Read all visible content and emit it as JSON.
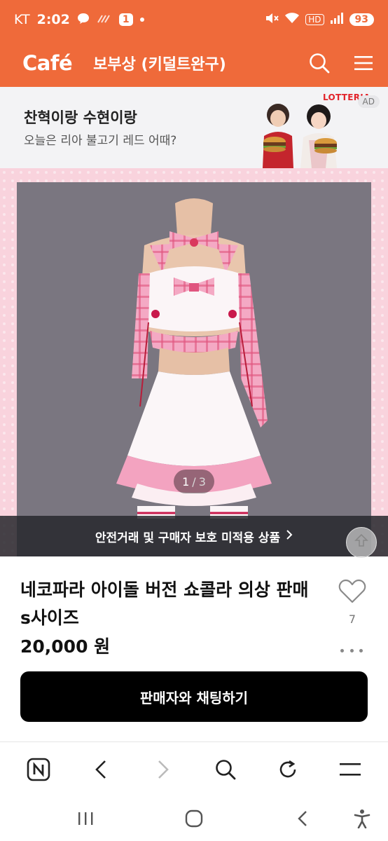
{
  "status_bar": {
    "carrier": "KT",
    "time": "2:02",
    "notification_count": "1",
    "network": "HD",
    "battery": "93"
  },
  "header": {
    "logo": "Café",
    "cafe_name": "보부상 (키덜트완구)"
  },
  "ad": {
    "title": "찬혁이랑 수현이랑",
    "subtitle": "오늘은 리아 불고기 레드 어때?",
    "brand": "LOTTERIA",
    "badge": "AD"
  },
  "gallery": {
    "current": "1",
    "separator": "/",
    "total": "3",
    "safety_notice": "안전거래 및 구매자 보호 미적용 상품"
  },
  "product": {
    "title": "네코파라 아이돌 버전 쇼콜라 의상 판매 s사이즈",
    "price": "20,000 원",
    "likes": "7"
  },
  "chat_button": {
    "label": "판매자와 채팅하기"
  },
  "colors": {
    "brand_orange": "#ef6a3a",
    "ad_brand_red": "#e2232a"
  },
  "icons": {
    "header": [
      "search-icon",
      "menu-icon"
    ],
    "browser_nav": [
      "naver-home-icon",
      "back-icon",
      "forward-icon",
      "search-icon",
      "refresh-icon",
      "menu-icon"
    ],
    "system_nav": [
      "recent-apps-icon",
      "home-icon",
      "back-icon",
      "accessibility-icon"
    ]
  }
}
